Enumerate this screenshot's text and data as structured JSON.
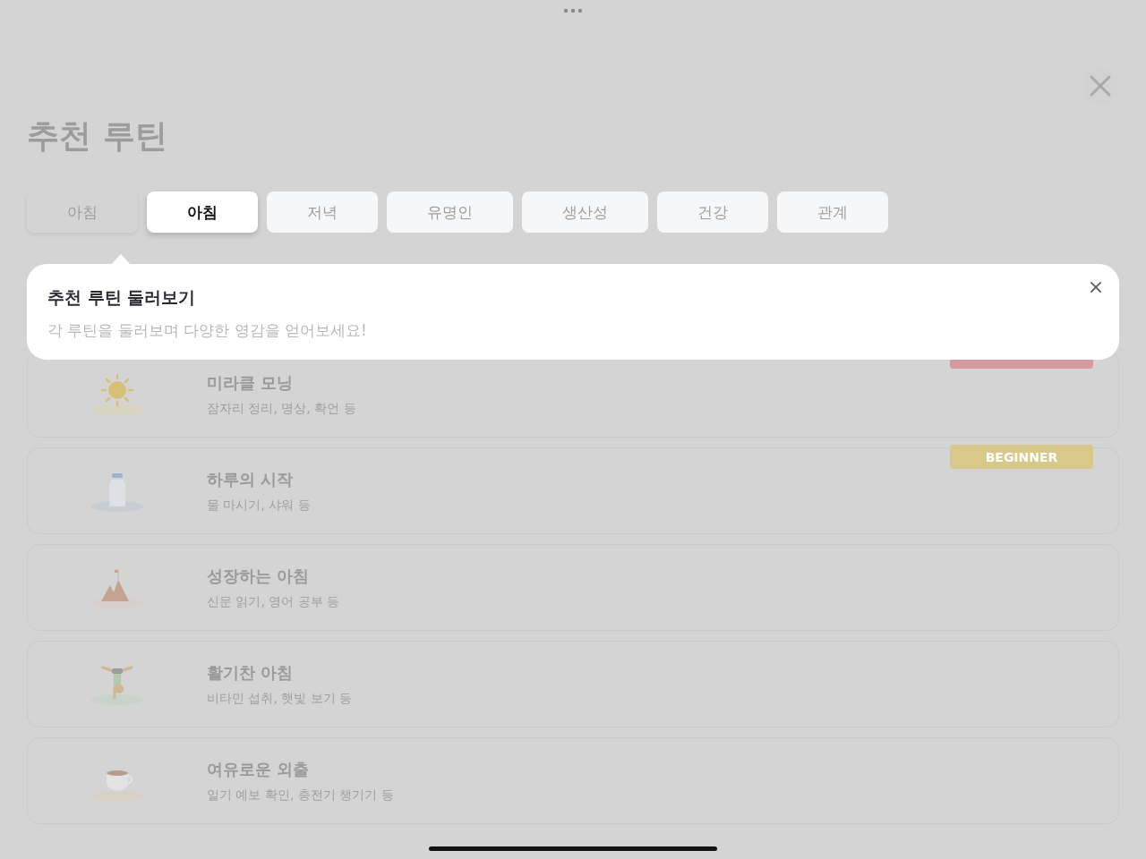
{
  "title": "추천 루틴",
  "tabs": [
    {
      "label": "아침",
      "kind": "ghost",
      "selected": false
    },
    {
      "label": "아침",
      "kind": "chip",
      "selected": true
    },
    {
      "label": "저녁",
      "kind": "chip",
      "selected": false
    },
    {
      "label": "유명인",
      "kind": "chip",
      "selected": false
    },
    {
      "label": "생산성",
      "kind": "chip",
      "selected": false
    },
    {
      "label": "건강",
      "kind": "chip",
      "selected": false
    },
    {
      "label": "관계",
      "kind": "chip",
      "selected": false
    }
  ],
  "tooltip": {
    "title": "추천 루틴 둘러보기",
    "text": "각 루틴을 둘러보며 다양한 영감을 얻어보세요!"
  },
  "routines": [
    {
      "title": "미라클 모닝",
      "subtitle": "잠자리 정리, 명상, 확언 등",
      "badge": {
        "color": "#d69a9e"
      }
    },
    {
      "title": "하루의 시작",
      "subtitle": "물 마시기, 샤워 등",
      "badge": {
        "label": "BEGINNER",
        "color": "#d8c98a"
      }
    },
    {
      "title": "성장하는 아침",
      "subtitle": "신문 읽기, 영어 공부 등"
    },
    {
      "title": "활기찬 아침",
      "subtitle": "비타민 섭취, 햇빛 보기 등"
    },
    {
      "title": "여유로운 외출",
      "subtitle": "일기 예보 확인, 충전기 챙기기 등"
    }
  ]
}
